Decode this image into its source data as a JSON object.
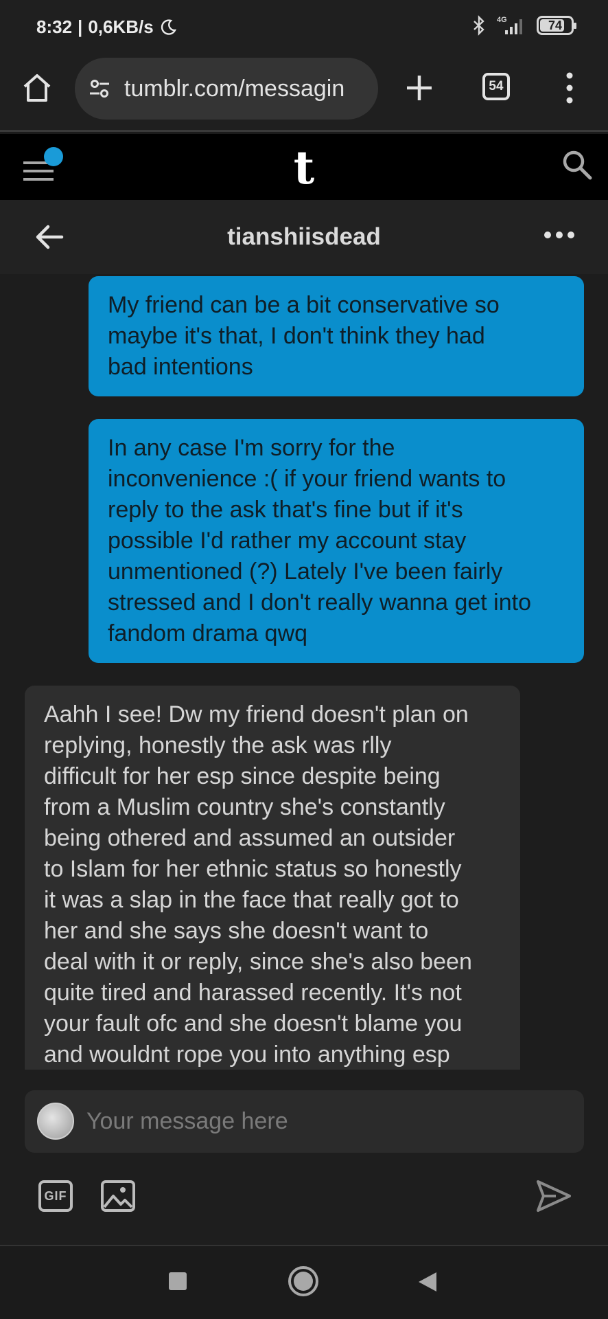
{
  "status_bar": {
    "time": "8:32",
    "network_speed": "0,6KB/s",
    "network_type": "4G",
    "battery": "74",
    "icons": [
      "moon-icon",
      "bluetooth-icon",
      "signal-icon",
      "battery-icon"
    ]
  },
  "browser": {
    "url": "tumblr.com/messagin",
    "tab_count": "54",
    "icons": [
      "home-icon",
      "site-settings-icon",
      "plus-icon",
      "tabs-icon",
      "more-vertical-icon"
    ]
  },
  "tumblr_header": {
    "logo": "t",
    "icons": [
      "menu-icon",
      "search-icon"
    ],
    "notification_color": "#1a9bd8"
  },
  "conversation": {
    "title": "tianshiisdead",
    "icons": [
      "back-arrow-icon",
      "more-horizontal-icon"
    ]
  },
  "messages": [
    {
      "direction": "sent",
      "lines": [
        "My friend can be a bit conservative so",
        "maybe it's that, I don't think they had",
        "bad intentions"
      ]
    },
    {
      "direction": "sent",
      "lines": [
        "In any case I'm sorry for the",
        "inconvenience :( if your friend wants to",
        "reply to the ask that's fine but if it's",
        "possible I'd rather my account stay",
        "unmentioned (?) Lately I've been fairly",
        "stressed and I don't really wanna get into",
        "fandom drama qwq"
      ]
    },
    {
      "direction": "received",
      "lines": [
        "Aahh I see! Dw my friend doesn't plan on",
        "replying, honestly the ask was rlly",
        "difficult for her esp since despite being",
        "from a Muslim country she's constantly",
        "being othered and assumed an outsider",
        "to Islam for her ethnic status so honestly",
        "it was a slap in the face that really got to",
        "her and she says she doesn't want to",
        "deal with it or reply, since she's also been",
        "quite tired and harassed recently. It's not",
        "your fault ofc and she doesn't blame you",
        "and wouldnt rope you into anything esp"
      ]
    }
  ],
  "composer": {
    "placeholder": "Your message here",
    "value": "",
    "gif_label": "GIF",
    "icons": [
      "avatar",
      "gif-icon",
      "image-icon",
      "send-icon"
    ]
  },
  "colors": {
    "sent_bubble": "#0a8ecc",
    "received_bubble": "#2e2e2e",
    "background": "#1d1d1d",
    "header": "#000000"
  }
}
